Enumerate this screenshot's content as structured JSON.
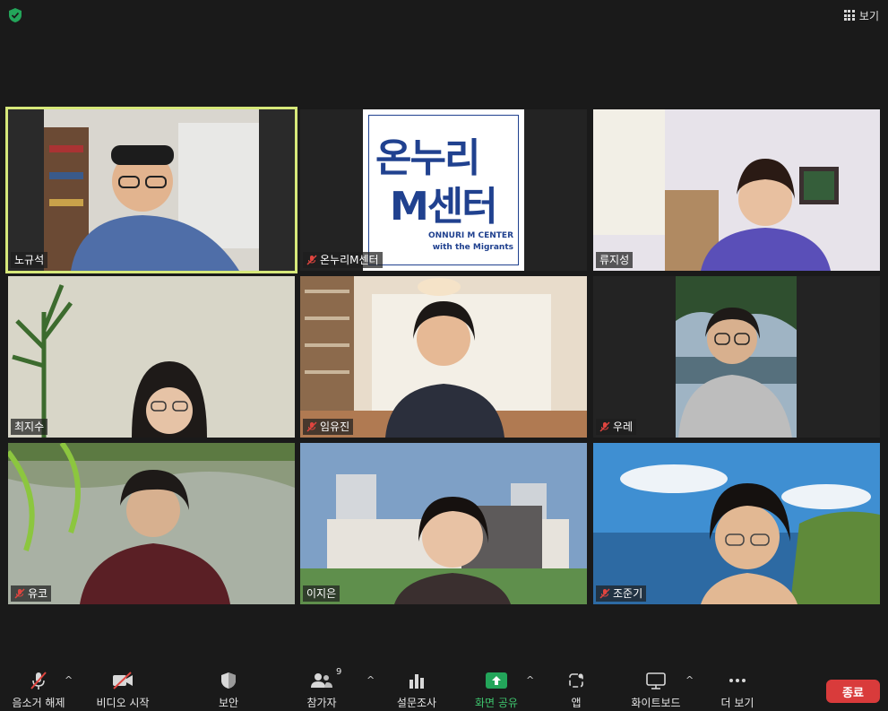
{
  "topbar": {
    "view_label": "보기",
    "view_icon": "grid-icon",
    "security_icon": "shield-check-icon"
  },
  "colors": {
    "active_speaker": "#d6e87a",
    "end_button": "#d93b3b",
    "share_green": "#3ec46d",
    "mute_red": "#e0453f"
  },
  "participants": [
    {
      "name": "노규석",
      "muted": false,
      "active": true
    },
    {
      "name": "온누리M센터",
      "muted": true,
      "active": false,
      "logo": {
        "line1": "온누리",
        "line2": "M센터",
        "en1": "ONNURI M CENTER",
        "en2": "with the Migrants"
      }
    },
    {
      "name": "류지성",
      "muted": false,
      "active": false
    },
    {
      "name": "최지수",
      "muted": false,
      "active": false
    },
    {
      "name": "임유진",
      "muted": true,
      "active": false
    },
    {
      "name": "우레",
      "muted": true,
      "active": false
    },
    {
      "name": "유코",
      "muted": true,
      "active": false
    },
    {
      "name": "이지은",
      "muted": false,
      "active": false
    },
    {
      "name": "조준기",
      "muted": true,
      "active": false
    }
  ],
  "toolbar": {
    "unmute": "음소거 해제",
    "start_video": "비디오 시작",
    "security": "보안",
    "participants": "참가자",
    "participants_count": "9",
    "polls": "설문조사",
    "share_screen": "화면 공유",
    "apps": "앱",
    "whiteboard": "화이트보드",
    "more": "더 보기",
    "end": "종료",
    "caret": "^"
  }
}
